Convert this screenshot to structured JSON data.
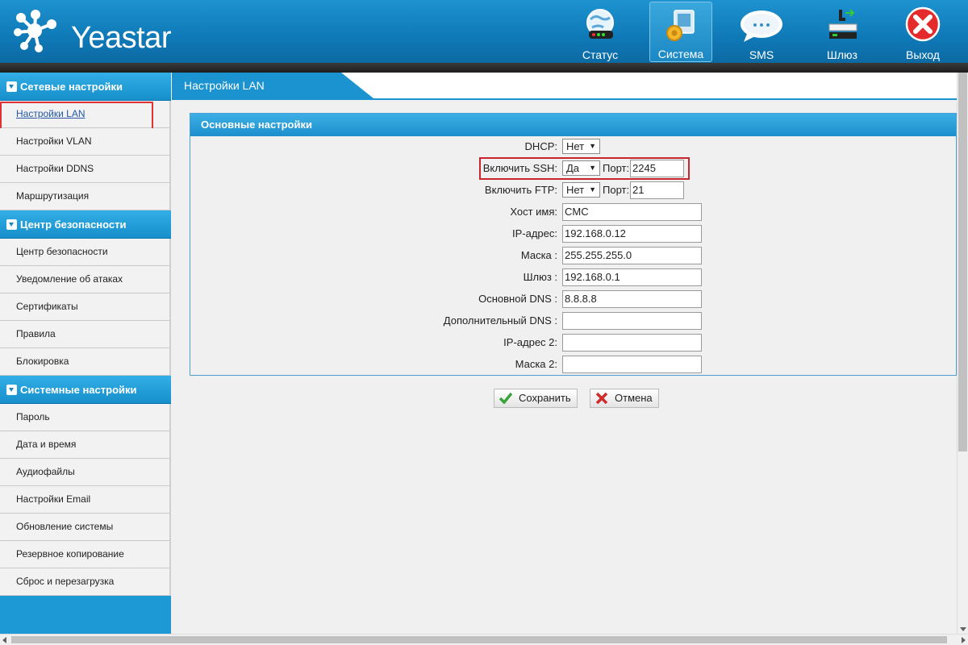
{
  "brand": {
    "name": "Yeastar"
  },
  "nav": [
    {
      "id": "status",
      "label": "Статус",
      "icon": "globe-status-icon"
    },
    {
      "id": "system",
      "label": "Система",
      "icon": "system-gear-icon",
      "active": true
    },
    {
      "id": "sms",
      "label": "SMS",
      "icon": "sms-bubble-icon"
    },
    {
      "id": "gateway",
      "label": "Шлюз",
      "icon": "gateway-phone-icon"
    },
    {
      "id": "logout",
      "label": "Выход",
      "icon": "exit-x-icon"
    }
  ],
  "sidebar": {
    "groups": [
      {
        "title": "Сетевые настройки",
        "items": [
          "Настройки LAN",
          "Настройки VLAN",
          "Настройки DDNS",
          "Маршрутизация"
        ]
      },
      {
        "title": "Центр безопасности",
        "items": [
          "Центр безопасности",
          "Уведомление об атаках",
          "Сертификаты",
          "Правила",
          "Блокировка"
        ]
      },
      {
        "title": "Системные настройки",
        "items": [
          "Пароль",
          "Дата и время",
          "Аудиофайлы",
          "Настройки Email",
          "Обновление системы",
          "Резервное копирование",
          "Сброс и перезагрузка"
        ]
      }
    ],
    "active_item": "Настройки LAN"
  },
  "page": {
    "tab_title": "Настройки LAN",
    "panel_title": "Основные настройки"
  },
  "form": {
    "dhcp": {
      "label": "DHCP:",
      "value": "Нет"
    },
    "ssh": {
      "label": "Включить SSH:",
      "value": "Да",
      "port_label": "Порт:",
      "port": "2245"
    },
    "ftp": {
      "label": "Включить FTP:",
      "value": "Нет",
      "port_label": "Порт:",
      "port": "21"
    },
    "hostname": {
      "label": "Хост имя:",
      "value": "CMC"
    },
    "ip": {
      "label": "IP-адрес:",
      "value": "192.168.0.12"
    },
    "mask": {
      "label": "Маска :",
      "value": "255.255.255.0"
    },
    "gateway": {
      "label": "Шлюз :",
      "value": "192.168.0.1"
    },
    "dns1": {
      "label": "Основной DNS :",
      "value": "8.8.8.8"
    },
    "dns2": {
      "label": "Дополнительный DNS :",
      "value": ""
    },
    "ip2": {
      "label": "IP-адрес 2:",
      "value": ""
    },
    "mask2": {
      "label": "Маска 2:",
      "value": ""
    }
  },
  "actions": {
    "save": "Сохранить",
    "cancel": "Отмена"
  },
  "colors": {
    "header_blue": "#1184c4",
    "sidebar_blue": "#1d9ad6",
    "highlight_red": "#c9252c"
  }
}
